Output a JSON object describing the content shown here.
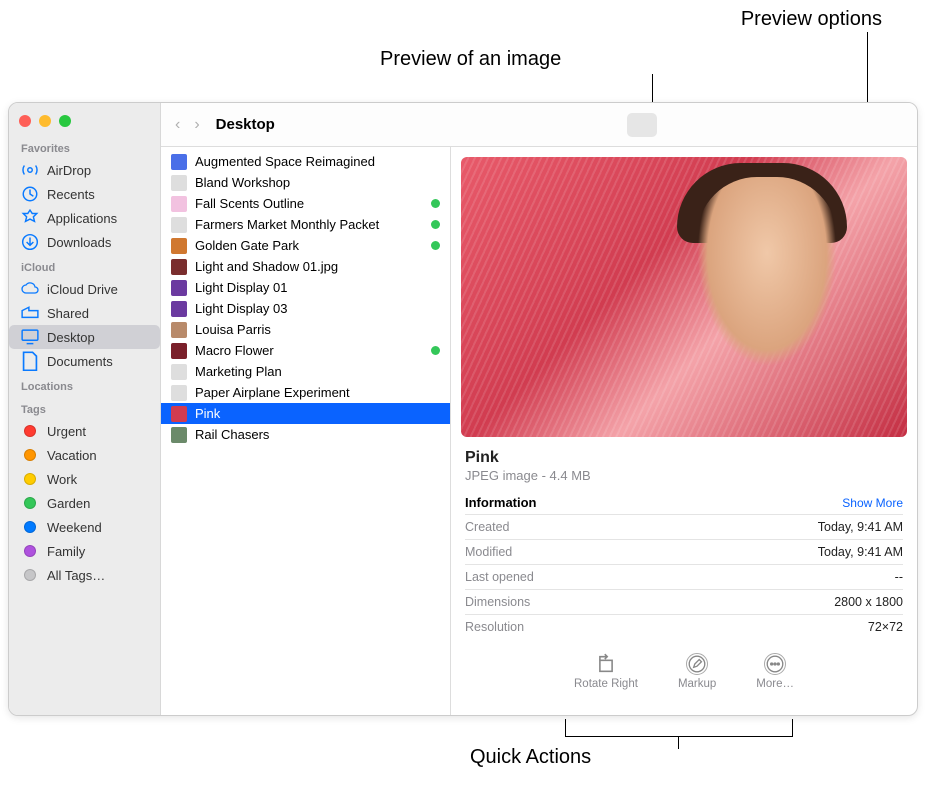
{
  "callouts": {
    "preview_options": "Preview options",
    "preview_image": "Preview of an image",
    "quick_actions": "Quick Actions"
  },
  "toolbar": {
    "title": "Desktop"
  },
  "sidebar": {
    "sections": {
      "favorites": "Favorites",
      "icloud": "iCloud",
      "locations": "Locations",
      "tags": "Tags"
    },
    "favorites": [
      {
        "label": "AirDrop"
      },
      {
        "label": "Recents"
      },
      {
        "label": "Applications"
      },
      {
        "label": "Downloads"
      }
    ],
    "icloud": [
      {
        "label": "iCloud Drive"
      },
      {
        "label": "Shared"
      },
      {
        "label": "Desktop",
        "selected": true
      },
      {
        "label": "Documents"
      }
    ],
    "tags": [
      {
        "label": "Urgent",
        "color": "#ff3b30"
      },
      {
        "label": "Vacation",
        "color": "#ff9500"
      },
      {
        "label": "Work",
        "color": "#ffcc00"
      },
      {
        "label": "Garden",
        "color": "#34c759"
      },
      {
        "label": "Weekend",
        "color": "#007aff"
      },
      {
        "label": "Family",
        "color": "#af52de"
      },
      {
        "label": "All Tags…",
        "color": "#c6c6c8"
      }
    ]
  },
  "files": [
    {
      "name": "Augmented Space Reimagined",
      "icon_bg": "#4a6fe8"
    },
    {
      "name": "Bland Workshop",
      "icon_bg": "#dedede"
    },
    {
      "name": "Fall Scents Outline",
      "icon_bg": "#f2c2e0",
      "tagged": true
    },
    {
      "name": "Farmers Market Monthly Packet",
      "icon_bg": "#dedede",
      "tagged": true
    },
    {
      "name": "Golden Gate Park",
      "icon_bg": "#d07830",
      "tagged": true
    },
    {
      "name": "Light and Shadow 01.jpg",
      "icon_bg": "#7a2e2e"
    },
    {
      "name": "Light Display 01",
      "icon_bg": "#6b3aa0"
    },
    {
      "name": "Light Display 03",
      "icon_bg": "#6b3aa0"
    },
    {
      "name": "Louisa Parris",
      "icon_bg": "#b88a6a"
    },
    {
      "name": "Macro Flower",
      "icon_bg": "#7a1f2a",
      "tagged": true
    },
    {
      "name": "Marketing Plan",
      "icon_bg": "#dedede"
    },
    {
      "name": "Paper Airplane Experiment",
      "icon_bg": "#dedede"
    },
    {
      "name": "Pink",
      "icon_bg": "#d13c50",
      "selected": true
    },
    {
      "name": "Rail Chasers",
      "icon_bg": "#6b8a6a"
    }
  ],
  "preview": {
    "title": "Pink",
    "subtitle": "JPEG image - 4.4 MB",
    "info_label": "Information",
    "show_more": "Show More",
    "rows": [
      {
        "k": "Created",
        "v": "Today, 9:41 AM"
      },
      {
        "k": "Modified",
        "v": "Today, 9:41 AM"
      },
      {
        "k": "Last opened",
        "v": "--"
      },
      {
        "k": "Dimensions",
        "v": "2800 x 1800"
      },
      {
        "k": "Resolution",
        "v": "72×72"
      }
    ],
    "quick_actions": [
      {
        "label": "Rotate Right"
      },
      {
        "label": "Markup"
      },
      {
        "label": "More…"
      }
    ]
  }
}
